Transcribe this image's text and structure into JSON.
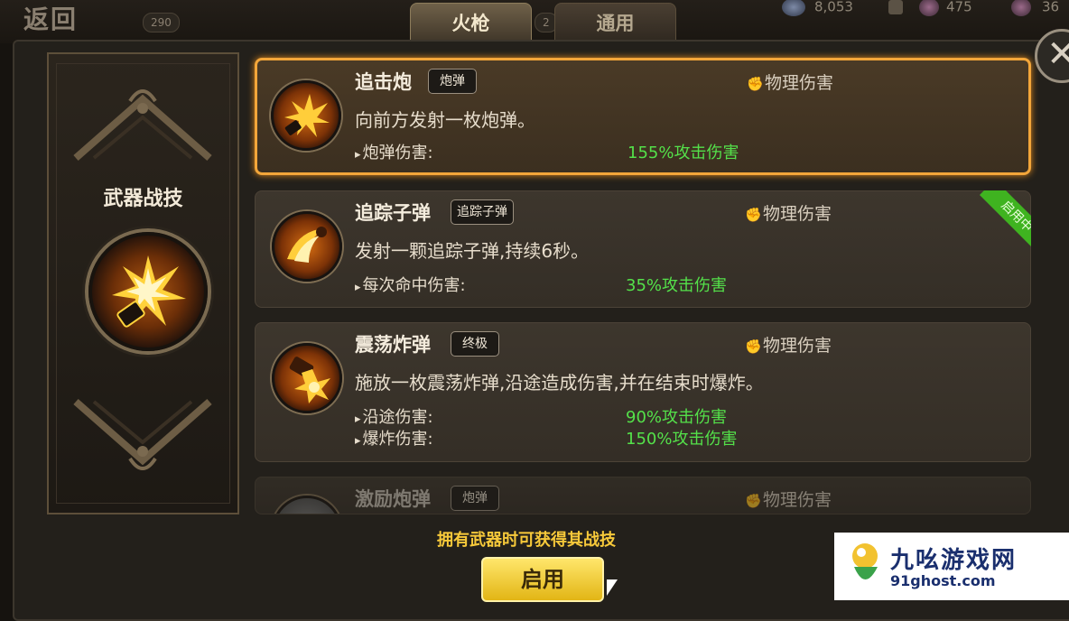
{
  "topbar": {
    "back_label": "返回",
    "level_badge": "290",
    "badge_2": "2",
    "resources": [
      {
        "name": "currency-1",
        "value": "8,053"
      },
      {
        "name": "currency-2",
        "value": "475"
      },
      {
        "name": "currency-3",
        "value": "36"
      }
    ],
    "tabs": [
      {
        "label": "火枪",
        "active": true
      },
      {
        "label": "通用",
        "active": false
      }
    ]
  },
  "emblem": {
    "title": "武器战技"
  },
  "skills": [
    {
      "name": "追击炮",
      "tag": "炮弹",
      "damage_type": "物理伤害",
      "description": "向前方发射一枚炮弹。",
      "stats": [
        {
          "label": "炮弹伤害:",
          "value": "155%攻击伤害"
        }
      ],
      "selected": true,
      "active": false
    },
    {
      "name": "追踪子弹",
      "tag": "追踪子弹",
      "damage_type": "物理伤害",
      "description": "发射一颗追踪子弹,持续6秒。",
      "stats": [
        {
          "label": "每次命中伤害:",
          "value": "35%攻击伤害"
        }
      ],
      "selected": false,
      "active": true,
      "active_label": "启用中"
    },
    {
      "name": "震荡炸弹",
      "tag": "终极",
      "damage_type": "物理伤害",
      "description": "施放一枚震荡炸弹,沿途造成伤害,并在结束时爆炸。",
      "stats": [
        {
          "label": "沿途伤害:",
          "value": "90%攻击伤害"
        },
        {
          "label": "爆炸伤害:",
          "value": "150%攻击伤害"
        }
      ],
      "selected": false,
      "active": false
    },
    {
      "name": "激励炮弹",
      "tag": "炮弹",
      "damage_type": "物理伤害",
      "selected": false,
      "active": false
    }
  ],
  "footer": {
    "hint": "拥有武器时可获得其战技",
    "enable_label": "启用"
  },
  "watermark": {
    "title": "九吆游戏网",
    "url": "91ghost.com"
  },
  "colors": {
    "highlight_border": "#f3a63a",
    "stat_value": "#54e14a",
    "hint_text": "#f7c93a",
    "button_gold": "#e2b515",
    "active_ribbon": "#3fb320"
  }
}
